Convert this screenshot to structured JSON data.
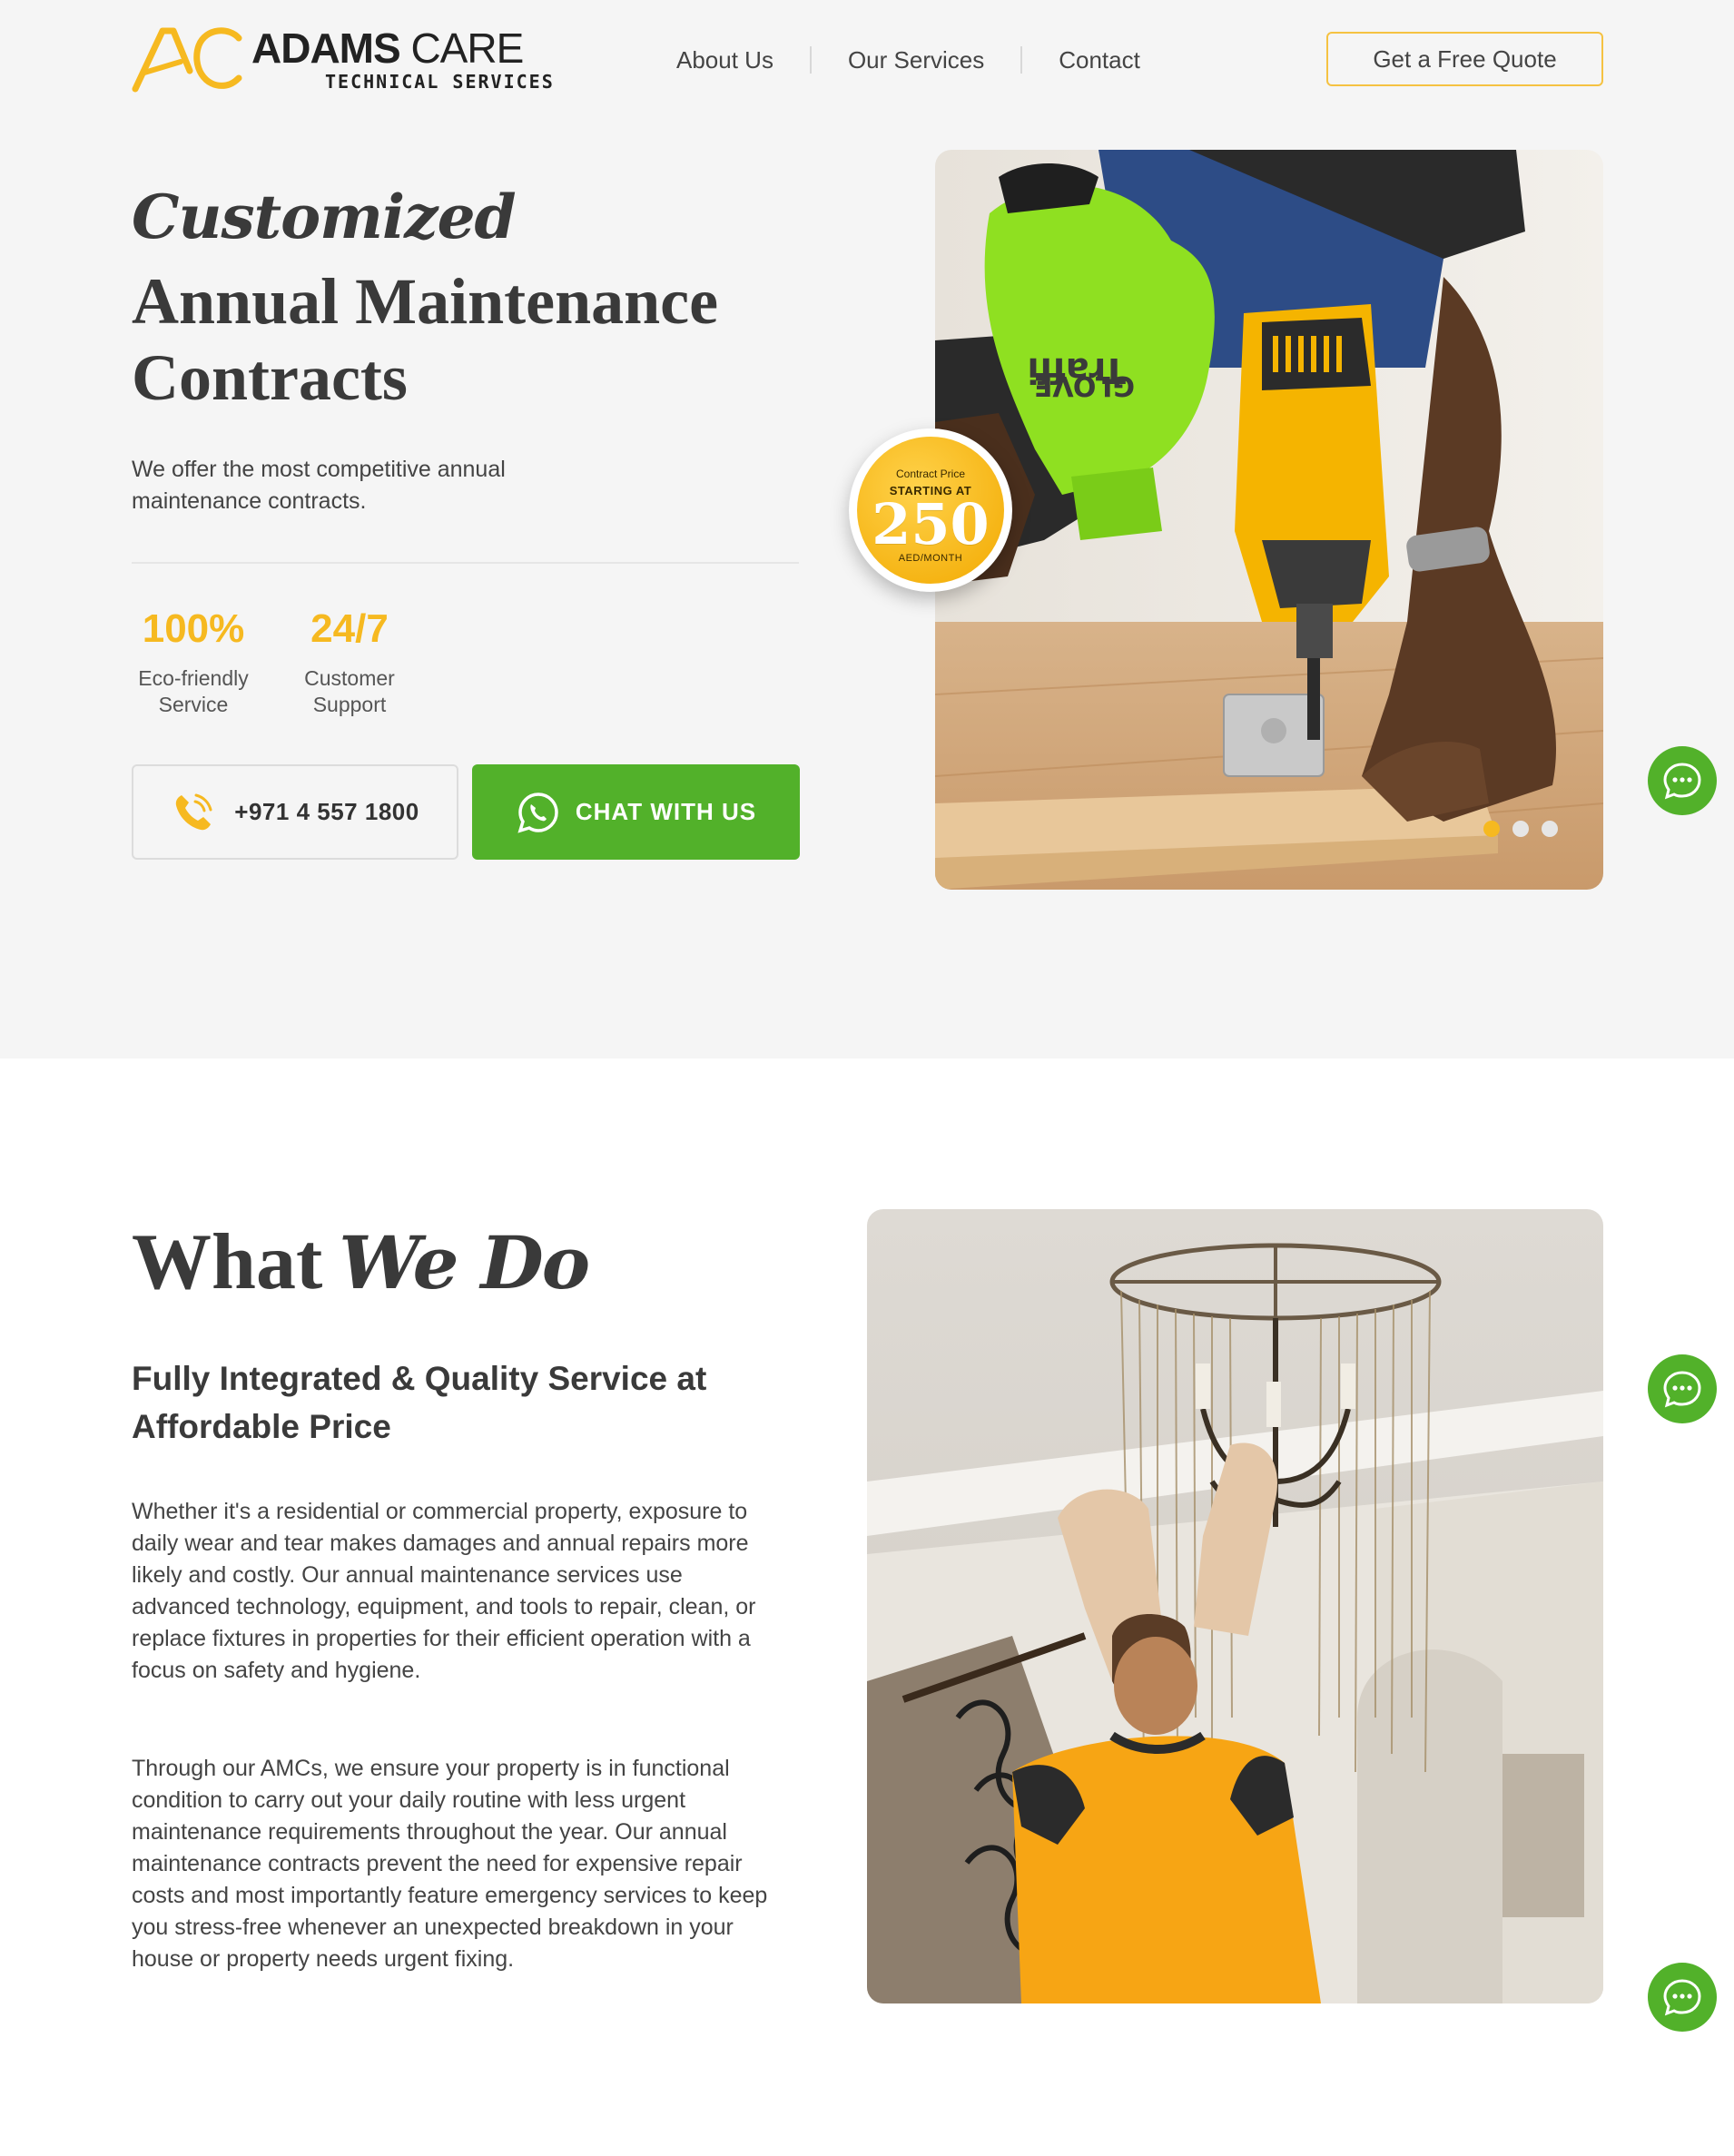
{
  "brand": {
    "name_bold": "ADAMS",
    "name_light": "CARE",
    "tagline": "TECHNICAL SERVICES",
    "accent": "#F6B920",
    "green": "#52B12A"
  },
  "nav": {
    "items": [
      {
        "label": "About Us"
      },
      {
        "label": "Our Services"
      },
      {
        "label": "Contact"
      }
    ],
    "cta_label": "Get a Free Quote"
  },
  "hero": {
    "title_em": "Customized",
    "title": "Annual Maintenance Contracts",
    "subtitle": "We offer the most competitive annual maintenance contracts.",
    "stats": [
      {
        "value": "100%",
        "label": "Eco-friendly Service"
      },
      {
        "value": "24/7",
        "label": "Customer Support"
      }
    ],
    "phone": "+971 4 557 1800",
    "chat_label": "CHAT WITH US",
    "badge": {
      "line1": "Contract Price",
      "line2": "STARTING AT",
      "number": "250",
      "unit": "AED/MONTH"
    },
    "slider": {
      "slides": 3,
      "active": 1
    }
  },
  "what_we_do": {
    "title": "What",
    "title_em": "We Do",
    "subtitle": "Fully Integrated & Quality Service at Affordable Price",
    "para1": "Whether it's a residential or commercial property, exposure to daily wear and tear makes damages and annual repairs more likely and costly. Our annual maintenance services use advanced technology, equipment, and tools to repair, clean, or replace fixtures in properties for their efficient operation with a focus on safety and hygiene.",
    "para2": "Through our AMCs, we ensure your property is in functional condition to carry out your daily routine with less urgent maintenance requirements throughout the year. Our annual maintenance contracts prevent the need for expensive repair costs and most importantly feature emergency services to keep you stress-free whenever an unexpected breakdown in your house or property needs urgent fixing."
  },
  "icons": [
    "phone-icon",
    "whatsapp-icon",
    "chat-bubble-icon"
  ]
}
